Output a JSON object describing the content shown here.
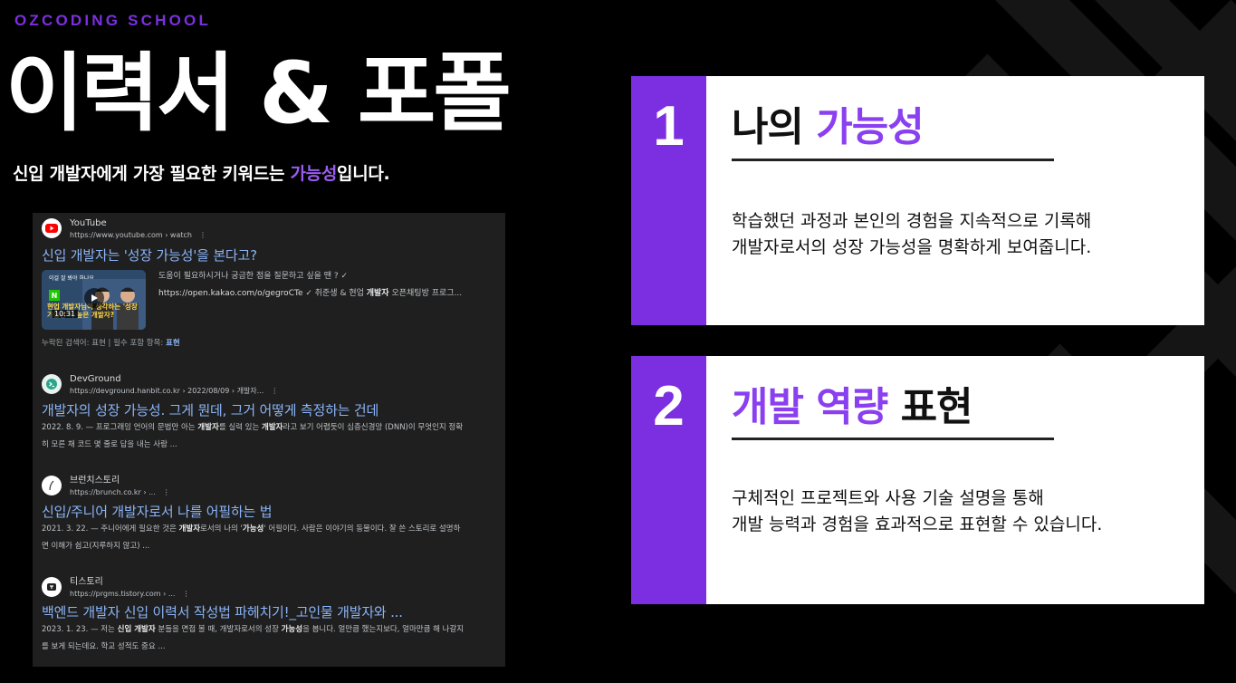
{
  "brand": "OZCODING SCHOOL",
  "title": "이력서 & 포폴",
  "subtitle": {
    "before": "신입 개발자에게 가장 필요한 키워드는 ",
    "accent": "가능성",
    "after": "입니다."
  },
  "colors": {
    "accent": "#7b2fe0",
    "link": "#8ab4f8",
    "panel": "#1f1f1f"
  },
  "search_results": {
    "youtube": {
      "source": "YouTube",
      "url": "https://www.youtube.com › watch",
      "title": "신입 개발자는 '성장 가능성'을 본다고?",
      "thumb_top": "이걸 잘 봐야 하나요...",
      "thumb_caption": "현업 개발자님이 생각하는 '성장 가능성'이 높은 개발자?",
      "duration": "10:31",
      "desc_line1": "도움이 필요하시거나 궁금한 점을 질문하고 싶을 땐 ? ✓",
      "desc_line2_link": "https://open.kakao.com/o/gegroCTe",
      "desc_line2_rest": " ✓ 취준생 & 현업 ",
      "desc_line2_bold": "개발자",
      "desc_line2_end": " 오픈채팅방 프로그...",
      "missing_label": "누락된 검색어: 표현 | 필수 포함 항목: ",
      "missing_link": "표현"
    },
    "devground": {
      "source": "DevGround",
      "url": "https://devground.hanbit.co.kr › 2022/08/09 › 개발자...",
      "title": "개발자의 성장 가능성. 그게 뭔데, 그거 어떻게 측정하는 건데",
      "snippet_1": "2022. 8. 9. — 프로그래밍 언어의 문법만 아는 ",
      "snippet_b1": "개발자",
      "snippet_2": "를 실력 있는 ",
      "snippet_b2": "개발자",
      "snippet_3": "라고 보기 어렵듯이 심층신경망 (DNN)이 무엇인지 정확히 모른 채 코드 몇 줄로 답을 내는 사람 ..."
    },
    "brunch": {
      "source": "브런치스토리",
      "url": "https://brunch.co.kr › ...",
      "title": "신입/주니어 개발자로서 나를 어필하는 법",
      "snippet_1": "2021. 3. 22. — 주니어에게 필요한 것은 ",
      "snippet_b1": "개발자",
      "snippet_2": "로서의 나의 '",
      "snippet_b2": "가능성",
      "snippet_3": "' 어필이다. 사람은 이야기의 동물이다. 잘 쓴 스토리로 설명하면 이해가 쉽고(지루하지 않고) ..."
    },
    "tistory": {
      "source": "티스토리",
      "url": "https://prgms.tistory.com › ...",
      "title": "백엔드 개발자 신입 이력서 작성법 파헤치기!_고인물 개발자와 ...",
      "snippet_1": "2023. 1. 23. — 저는 ",
      "snippet_b1": "신입 개발자",
      "snippet_2": " 분들을 면접 볼 때, 개발자로서의 성장 ",
      "snippet_b2": "가능성",
      "snippet_3": "을 봅니다. 얼만큼 했는지보다, 얼마만큼 해 나갈지를 보게 되는데요. 학교 성적도 중요 ..."
    },
    "more_icon": "vertical-dots-icon"
  },
  "cards": [
    {
      "number": "1",
      "title_plain": "나의 ",
      "title_accent": "가능성",
      "body_line1": "학습했던 과정과 본인의 경험을 지속적으로 기록해",
      "body_line2": "개발자로서의 성장 가능성을 명확하게 보여줍니다."
    },
    {
      "number": "2",
      "title_accent": "개발 역량",
      "title_plain": " 표현",
      "body_line1": "구체적인 프로젝트와 사용 기술 설명을 통해",
      "body_line2": "개발 능력과 경험을 효과적으로 표현할 수 있습니다."
    }
  ]
}
